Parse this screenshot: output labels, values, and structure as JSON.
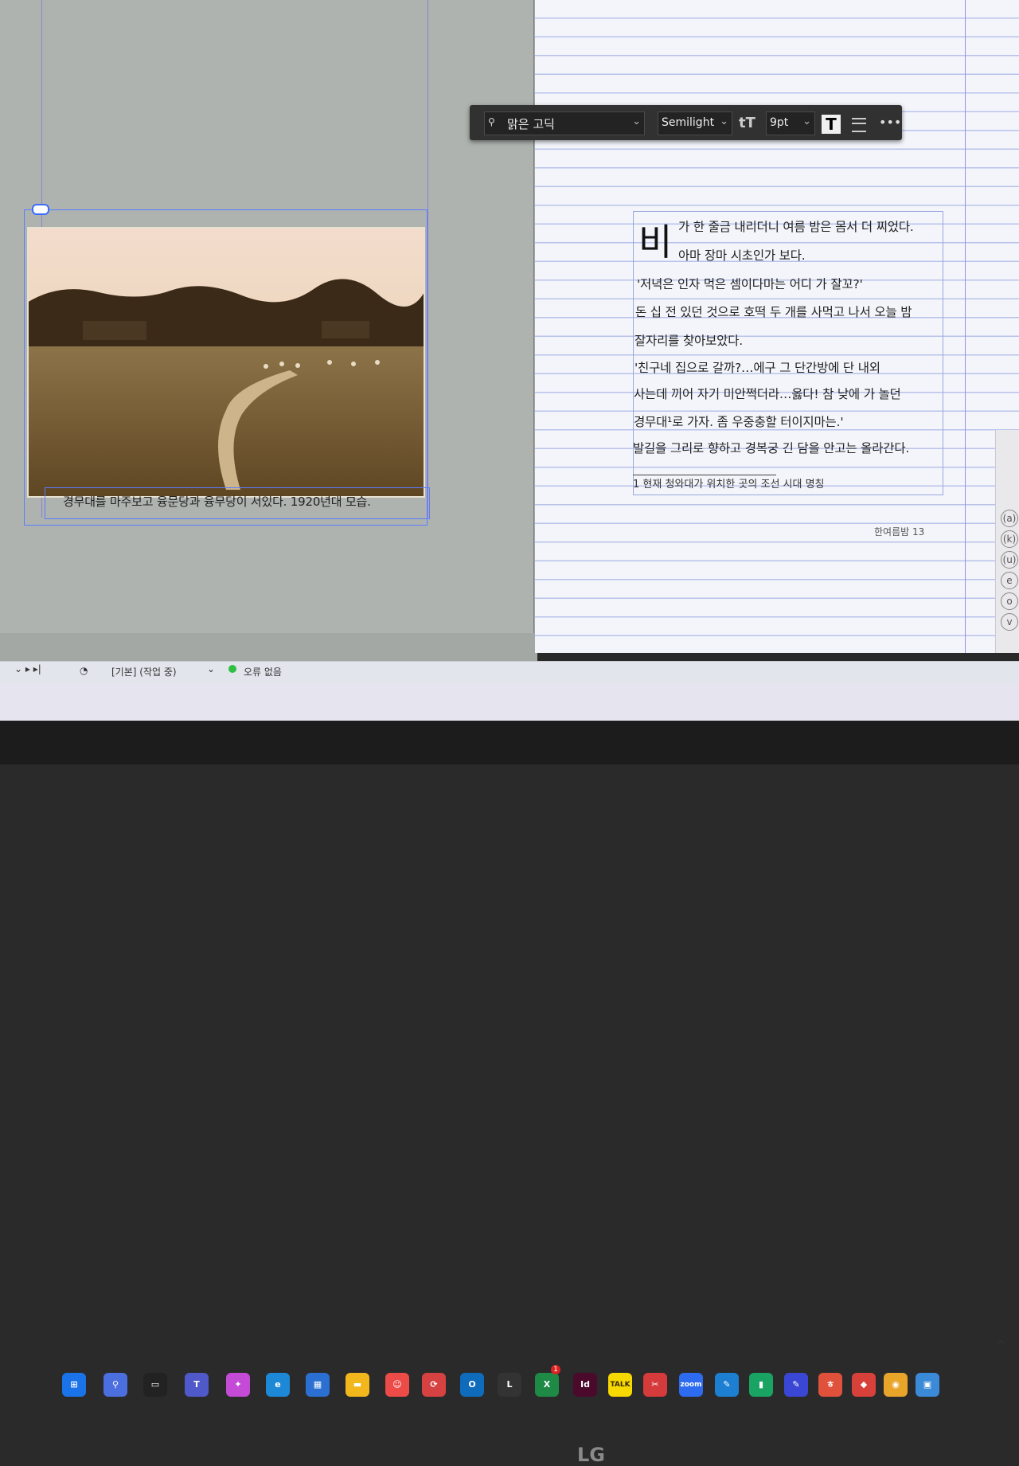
{
  "toolbar": {
    "search_icon_glyph": "⚲",
    "font_family": "맑은 고딕",
    "font_style": "Semilight",
    "font_size": "9pt",
    "dropdown_glyph": "⌄",
    "text_size_glyph": "tT",
    "text_glyph": "T",
    "more_glyph": "•••"
  },
  "left_page": {
    "caption": "경무대를 마주보고 융문당과 융무당이 서있다. 1920년대 모습."
  },
  "right_page": {
    "drop_cap": "비",
    "lines": [
      "가 한 줄금 내리더니 여름 밤은 몸서 더 찌었다.",
      "아마 장마 시초인가 보다.",
      "'저녁은 인자 먹은 셈이다마는 어디 가 잘꼬?'",
      "돈 십 전 있던 것으로 호떡 두 개를 사먹고 나서 오늘 밤",
      "잘자리를 찾아보았다.",
      "'친구네 집으로 갈까?…에구 그 단간방에 단 내외",
      "사는데 끼어 자기 미안쩍더라…옳다! 참 낮에 가 놀던",
      "경무대¹로 가자. 좀 우중충할 터이지마는.'",
      "발길을 그리로 향하고 경복궁 긴 담을 안고는 올라간다."
    ],
    "footnote": "1   현재 청와대가 위치한 곳의 조선 시대 명칭",
    "folio": "한여름밤   13"
  },
  "side_panel": {
    "glyphs": [
      "(a)",
      "(k)",
      "(u)",
      "e",
      "o",
      "v"
    ]
  },
  "status_bar": {
    "page_text": "[기본] (작업 중)",
    "preflight": "오류 없음"
  },
  "taskbar": {
    "badge_count": "1",
    "apps": [
      {
        "name": "outlook",
        "label": "O",
        "color": "#0f6cbd"
      },
      {
        "name": "app-l",
        "label": "L",
        "color": "#333"
      },
      {
        "name": "excel-notify",
        "label": "X",
        "color": "#1e8a45"
      },
      {
        "name": "indesign",
        "label": "Id",
        "color": "#4b0a2c"
      },
      {
        "name": "kakaotalk",
        "label": "TALK",
        "color": "#f6d900"
      },
      {
        "name": "app-scissors",
        "label": "✂",
        "color": "#d63b3b"
      },
      {
        "name": "zoom",
        "label": "zoom",
        "color": "#2d6cf0"
      },
      {
        "name": "app-pen",
        "label": "✎",
        "color": "#1d7fd1"
      },
      {
        "name": "sheets",
        "label": "▮",
        "color": "#19a463"
      },
      {
        "name": "notes",
        "label": "✎",
        "color": "#3a47d5"
      },
      {
        "name": "app-hangul",
        "label": "ㅎ",
        "color": "#e0513b"
      },
      {
        "name": "app-gift",
        "label": "◆",
        "color": "#d8403a"
      },
      {
        "name": "chrome",
        "label": "◉",
        "color": "#e9a42a"
      },
      {
        "name": "photos",
        "label": "▣",
        "color": "#3a8ad8"
      }
    ]
  },
  "monitor_brand": "LG"
}
